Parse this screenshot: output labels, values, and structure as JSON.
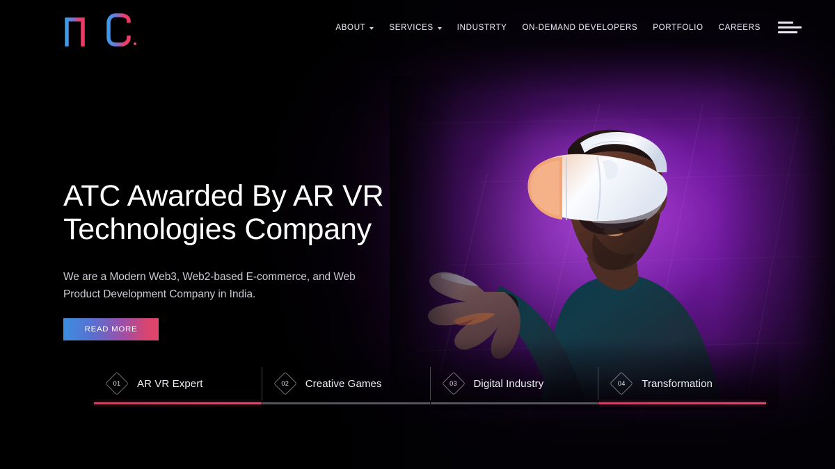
{
  "brand": {
    "logo_text": "ATC",
    "logo_mark": "atc-wordmark",
    "gradient_start": "#3d9ae8",
    "gradient_end": "#ef3a62",
    "trademark": "®"
  },
  "nav": {
    "items": [
      {
        "label": "ABOUT",
        "has_dropdown": true
      },
      {
        "label": "SERVICES",
        "has_dropdown": true
      },
      {
        "label": "INDUSTRTY",
        "has_dropdown": false
      },
      {
        "label": "ON-DEMAND DEVELOPERS",
        "has_dropdown": false
      },
      {
        "label": "PORTFOLIO",
        "has_dropdown": false
      },
      {
        "label": "CAREERS",
        "has_dropdown": false
      }
    ],
    "menu_icon": "hamburger-icon"
  },
  "hero": {
    "title": "ATC Awarded By AR VR\nTechnologies Company",
    "subtitle": "We are a Modern Web3, Web2-based E-commerce, and Web\nProduct Development Company in India.",
    "cta_label": "READ MORE",
    "cta_gradient_start": "#3b8fe0",
    "cta_gradient_end": "#e0476a",
    "image_alt": "man-wearing-vr-headset"
  },
  "feature_tabs": [
    {
      "number": "01",
      "label": "AR VR Expert",
      "active": true
    },
    {
      "number": "02",
      "label": "Creative Games",
      "active": false
    },
    {
      "number": "03",
      "label": "Digital Industry",
      "active": false
    },
    {
      "number": "04",
      "label": "Transformation",
      "active": true
    }
  ],
  "theme": {
    "background": "#050108",
    "accent_pink": "#ef2f59",
    "accent_purple": "#8a23b8",
    "text_primary": "#ffffff",
    "text_secondary": "#cdcbd4"
  }
}
